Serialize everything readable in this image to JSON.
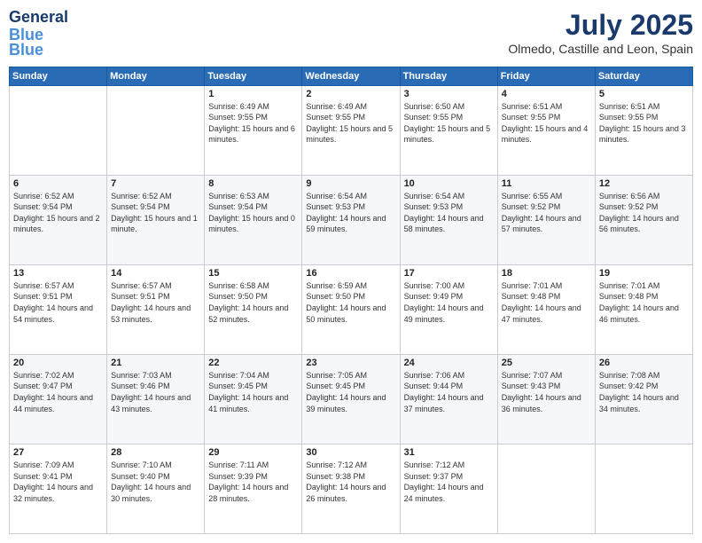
{
  "logo": {
    "line1": "General",
    "line2": "Blue"
  },
  "title": "July 2025",
  "subtitle": "Olmedo, Castille and Leon, Spain",
  "days_header": [
    "Sunday",
    "Monday",
    "Tuesday",
    "Wednesday",
    "Thursday",
    "Friday",
    "Saturday"
  ],
  "weeks": [
    [
      {
        "day": "",
        "sunrise": "",
        "sunset": "",
        "daylight": ""
      },
      {
        "day": "",
        "sunrise": "",
        "sunset": "",
        "daylight": ""
      },
      {
        "day": "1",
        "sunrise": "Sunrise: 6:49 AM",
        "sunset": "Sunset: 9:55 PM",
        "daylight": "Daylight: 15 hours and 6 minutes."
      },
      {
        "day": "2",
        "sunrise": "Sunrise: 6:49 AM",
        "sunset": "Sunset: 9:55 PM",
        "daylight": "Daylight: 15 hours and 5 minutes."
      },
      {
        "day": "3",
        "sunrise": "Sunrise: 6:50 AM",
        "sunset": "Sunset: 9:55 PM",
        "daylight": "Daylight: 15 hours and 5 minutes."
      },
      {
        "day": "4",
        "sunrise": "Sunrise: 6:51 AM",
        "sunset": "Sunset: 9:55 PM",
        "daylight": "Daylight: 15 hours and 4 minutes."
      },
      {
        "day": "5",
        "sunrise": "Sunrise: 6:51 AM",
        "sunset": "Sunset: 9:55 PM",
        "daylight": "Daylight: 15 hours and 3 minutes."
      }
    ],
    [
      {
        "day": "6",
        "sunrise": "Sunrise: 6:52 AM",
        "sunset": "Sunset: 9:54 PM",
        "daylight": "Daylight: 15 hours and 2 minutes."
      },
      {
        "day": "7",
        "sunrise": "Sunrise: 6:52 AM",
        "sunset": "Sunset: 9:54 PM",
        "daylight": "Daylight: 15 hours and 1 minute."
      },
      {
        "day": "8",
        "sunrise": "Sunrise: 6:53 AM",
        "sunset": "Sunset: 9:54 PM",
        "daylight": "Daylight: 15 hours and 0 minutes."
      },
      {
        "day": "9",
        "sunrise": "Sunrise: 6:54 AM",
        "sunset": "Sunset: 9:53 PM",
        "daylight": "Daylight: 14 hours and 59 minutes."
      },
      {
        "day": "10",
        "sunrise": "Sunrise: 6:54 AM",
        "sunset": "Sunset: 9:53 PM",
        "daylight": "Daylight: 14 hours and 58 minutes."
      },
      {
        "day": "11",
        "sunrise": "Sunrise: 6:55 AM",
        "sunset": "Sunset: 9:52 PM",
        "daylight": "Daylight: 14 hours and 57 minutes."
      },
      {
        "day": "12",
        "sunrise": "Sunrise: 6:56 AM",
        "sunset": "Sunset: 9:52 PM",
        "daylight": "Daylight: 14 hours and 56 minutes."
      }
    ],
    [
      {
        "day": "13",
        "sunrise": "Sunrise: 6:57 AM",
        "sunset": "Sunset: 9:51 PM",
        "daylight": "Daylight: 14 hours and 54 minutes."
      },
      {
        "day": "14",
        "sunrise": "Sunrise: 6:57 AM",
        "sunset": "Sunset: 9:51 PM",
        "daylight": "Daylight: 14 hours and 53 minutes."
      },
      {
        "day": "15",
        "sunrise": "Sunrise: 6:58 AM",
        "sunset": "Sunset: 9:50 PM",
        "daylight": "Daylight: 14 hours and 52 minutes."
      },
      {
        "day": "16",
        "sunrise": "Sunrise: 6:59 AM",
        "sunset": "Sunset: 9:50 PM",
        "daylight": "Daylight: 14 hours and 50 minutes."
      },
      {
        "day": "17",
        "sunrise": "Sunrise: 7:00 AM",
        "sunset": "Sunset: 9:49 PM",
        "daylight": "Daylight: 14 hours and 49 minutes."
      },
      {
        "day": "18",
        "sunrise": "Sunrise: 7:01 AM",
        "sunset": "Sunset: 9:48 PM",
        "daylight": "Daylight: 14 hours and 47 minutes."
      },
      {
        "day": "19",
        "sunrise": "Sunrise: 7:01 AM",
        "sunset": "Sunset: 9:48 PM",
        "daylight": "Daylight: 14 hours and 46 minutes."
      }
    ],
    [
      {
        "day": "20",
        "sunrise": "Sunrise: 7:02 AM",
        "sunset": "Sunset: 9:47 PM",
        "daylight": "Daylight: 14 hours and 44 minutes."
      },
      {
        "day": "21",
        "sunrise": "Sunrise: 7:03 AM",
        "sunset": "Sunset: 9:46 PM",
        "daylight": "Daylight: 14 hours and 43 minutes."
      },
      {
        "day": "22",
        "sunrise": "Sunrise: 7:04 AM",
        "sunset": "Sunset: 9:45 PM",
        "daylight": "Daylight: 14 hours and 41 minutes."
      },
      {
        "day": "23",
        "sunrise": "Sunrise: 7:05 AM",
        "sunset": "Sunset: 9:45 PM",
        "daylight": "Daylight: 14 hours and 39 minutes."
      },
      {
        "day": "24",
        "sunrise": "Sunrise: 7:06 AM",
        "sunset": "Sunset: 9:44 PM",
        "daylight": "Daylight: 14 hours and 37 minutes."
      },
      {
        "day": "25",
        "sunrise": "Sunrise: 7:07 AM",
        "sunset": "Sunset: 9:43 PM",
        "daylight": "Daylight: 14 hours and 36 minutes."
      },
      {
        "day": "26",
        "sunrise": "Sunrise: 7:08 AM",
        "sunset": "Sunset: 9:42 PM",
        "daylight": "Daylight: 14 hours and 34 minutes."
      }
    ],
    [
      {
        "day": "27",
        "sunrise": "Sunrise: 7:09 AM",
        "sunset": "Sunset: 9:41 PM",
        "daylight": "Daylight: 14 hours and 32 minutes."
      },
      {
        "day": "28",
        "sunrise": "Sunrise: 7:10 AM",
        "sunset": "Sunset: 9:40 PM",
        "daylight": "Daylight: 14 hours and 30 minutes."
      },
      {
        "day": "29",
        "sunrise": "Sunrise: 7:11 AM",
        "sunset": "Sunset: 9:39 PM",
        "daylight": "Daylight: 14 hours and 28 minutes."
      },
      {
        "day": "30",
        "sunrise": "Sunrise: 7:12 AM",
        "sunset": "Sunset: 9:38 PM",
        "daylight": "Daylight: 14 hours and 26 minutes."
      },
      {
        "day": "31",
        "sunrise": "Sunrise: 7:12 AM",
        "sunset": "Sunset: 9:37 PM",
        "daylight": "Daylight: 14 hours and 24 minutes."
      },
      {
        "day": "",
        "sunrise": "",
        "sunset": "",
        "daylight": ""
      },
      {
        "day": "",
        "sunrise": "",
        "sunset": "",
        "daylight": ""
      }
    ]
  ]
}
